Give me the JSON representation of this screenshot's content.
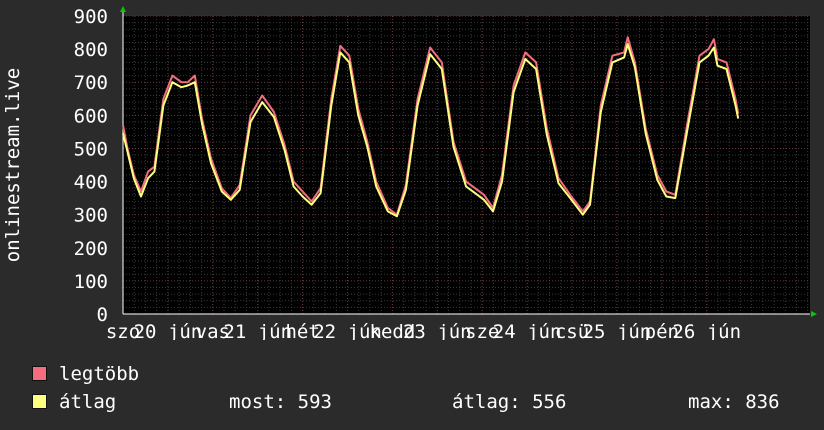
{
  "chart_data": {
    "type": "line",
    "ylabel": "onlinestream.live",
    "ylim": [
      0,
      900
    ],
    "yticks": [
      0,
      100,
      200,
      300,
      400,
      500,
      600,
      700,
      800,
      900
    ],
    "xlim": [
      0,
      7.65
    ],
    "grid": true,
    "xtick_labels": [
      {
        "x": 0.0,
        "text": "szo"
      },
      {
        "x": 0.5,
        "text": "20 jún"
      },
      {
        "x": 1.0,
        "text": "vas"
      },
      {
        "x": 1.5,
        "text": "21 jún"
      },
      {
        "x": 2.0,
        "text": "hét"
      },
      {
        "x": 2.5,
        "text": "22 jún"
      },
      {
        "x": 3.0,
        "text": "kedd"
      },
      {
        "x": 3.5,
        "text": "23 jún"
      },
      {
        "x": 4.0,
        "text": "sze"
      },
      {
        "x": 4.5,
        "text": "24 jún"
      },
      {
        "x": 5.0,
        "text": "csü"
      },
      {
        "x": 5.5,
        "text": "25 jún"
      },
      {
        "x": 6.0,
        "text": "pén"
      },
      {
        "x": 6.5,
        "text": "26 jún"
      }
    ],
    "series": [
      {
        "name": "legtöbb",
        "color": "#f26d7d",
        "points": [
          [
            0.0,
            570
          ],
          [
            0.05,
            500
          ],
          [
            0.12,
            420
          ],
          [
            0.2,
            370
          ],
          [
            0.28,
            430
          ],
          [
            0.35,
            445
          ],
          [
            0.45,
            650
          ],
          [
            0.55,
            720
          ],
          [
            0.65,
            700
          ],
          [
            0.72,
            700
          ],
          [
            0.8,
            720
          ],
          [
            0.88,
            590
          ],
          [
            0.98,
            470
          ],
          [
            1.1,
            380
          ],
          [
            1.2,
            350
          ],
          [
            1.3,
            390
          ],
          [
            1.42,
            600
          ],
          [
            1.55,
            660
          ],
          [
            1.68,
            610
          ],
          [
            1.8,
            510
          ],
          [
            1.9,
            400
          ],
          [
            2.0,
            370
          ],
          [
            2.1,
            340
          ],
          [
            2.2,
            380
          ],
          [
            2.32,
            650
          ],
          [
            2.42,
            810
          ],
          [
            2.52,
            780
          ],
          [
            2.62,
            620
          ],
          [
            2.72,
            520
          ],
          [
            2.82,
            400
          ],
          [
            2.95,
            320
          ],
          [
            3.05,
            300
          ],
          [
            3.15,
            390
          ],
          [
            3.28,
            650
          ],
          [
            3.42,
            805
          ],
          [
            3.55,
            760
          ],
          [
            3.68,
            520
          ],
          [
            3.82,
            400
          ],
          [
            3.92,
            380
          ],
          [
            4.02,
            360
          ],
          [
            4.12,
            320
          ],
          [
            4.22,
            420
          ],
          [
            4.35,
            690
          ],
          [
            4.48,
            790
          ],
          [
            4.6,
            760
          ],
          [
            4.72,
            560
          ],
          [
            4.85,
            410
          ],
          [
            4.98,
            360
          ],
          [
            5.12,
            310
          ],
          [
            5.2,
            340
          ],
          [
            5.32,
            630
          ],
          [
            5.45,
            780
          ],
          [
            5.58,
            790
          ],
          [
            5.62,
            836
          ],
          [
            5.7,
            760
          ],
          [
            5.82,
            560
          ],
          [
            5.95,
            420
          ],
          [
            6.05,
            370
          ],
          [
            6.15,
            360
          ],
          [
            6.28,
            570
          ],
          [
            6.42,
            780
          ],
          [
            6.52,
            800
          ],
          [
            6.58,
            830
          ],
          [
            6.62,
            770
          ],
          [
            6.72,
            760
          ],
          [
            6.82,
            650
          ],
          [
            6.85,
            605
          ]
        ]
      },
      {
        "name": "átlag",
        "color": "#ffff7f",
        "points": [
          [
            0.0,
            545
          ],
          [
            0.05,
            490
          ],
          [
            0.12,
            410
          ],
          [
            0.2,
            355
          ],
          [
            0.28,
            410
          ],
          [
            0.35,
            430
          ],
          [
            0.45,
            630
          ],
          [
            0.55,
            700
          ],
          [
            0.65,
            685
          ],
          [
            0.72,
            690
          ],
          [
            0.8,
            700
          ],
          [
            0.88,
            575
          ],
          [
            0.98,
            455
          ],
          [
            1.1,
            370
          ],
          [
            1.2,
            345
          ],
          [
            1.3,
            375
          ],
          [
            1.42,
            580
          ],
          [
            1.55,
            640
          ],
          [
            1.68,
            595
          ],
          [
            1.8,
            495
          ],
          [
            1.9,
            385
          ],
          [
            2.0,
            355
          ],
          [
            2.1,
            330
          ],
          [
            2.2,
            365
          ],
          [
            2.32,
            630
          ],
          [
            2.42,
            790
          ],
          [
            2.52,
            760
          ],
          [
            2.62,
            600
          ],
          [
            2.72,
            505
          ],
          [
            2.82,
            385
          ],
          [
            2.95,
            310
          ],
          [
            3.05,
            295
          ],
          [
            3.15,
            375
          ],
          [
            3.28,
            630
          ],
          [
            3.42,
            785
          ],
          [
            3.55,
            740
          ],
          [
            3.68,
            505
          ],
          [
            3.82,
            385
          ],
          [
            3.92,
            365
          ],
          [
            4.02,
            345
          ],
          [
            4.12,
            310
          ],
          [
            4.22,
            400
          ],
          [
            4.35,
            670
          ],
          [
            4.48,
            770
          ],
          [
            4.6,
            740
          ],
          [
            4.72,
            540
          ],
          [
            4.85,
            395
          ],
          [
            4.98,
            350
          ],
          [
            5.12,
            300
          ],
          [
            5.2,
            330
          ],
          [
            5.32,
            610
          ],
          [
            5.45,
            760
          ],
          [
            5.58,
            775
          ],
          [
            5.62,
            815
          ],
          [
            5.7,
            745
          ],
          [
            5.82,
            545
          ],
          [
            5.95,
            405
          ],
          [
            6.05,
            355
          ],
          [
            6.15,
            350
          ],
          [
            6.28,
            550
          ],
          [
            6.42,
            760
          ],
          [
            6.52,
            780
          ],
          [
            6.58,
            805
          ],
          [
            6.62,
            750
          ],
          [
            6.72,
            740
          ],
          [
            6.82,
            630
          ],
          [
            6.85,
            590
          ]
        ]
      }
    ]
  },
  "legend": {
    "items": [
      {
        "label": "legtöbb",
        "color": "#f26d7d"
      },
      {
        "label": "átlag",
        "color": "#ffff7f"
      }
    ],
    "stats": {
      "most_label": "most:",
      "most_value": "593",
      "avg_label": "átlag:",
      "avg_value": "556",
      "max_label": "max:",
      "max_value": "836"
    }
  }
}
